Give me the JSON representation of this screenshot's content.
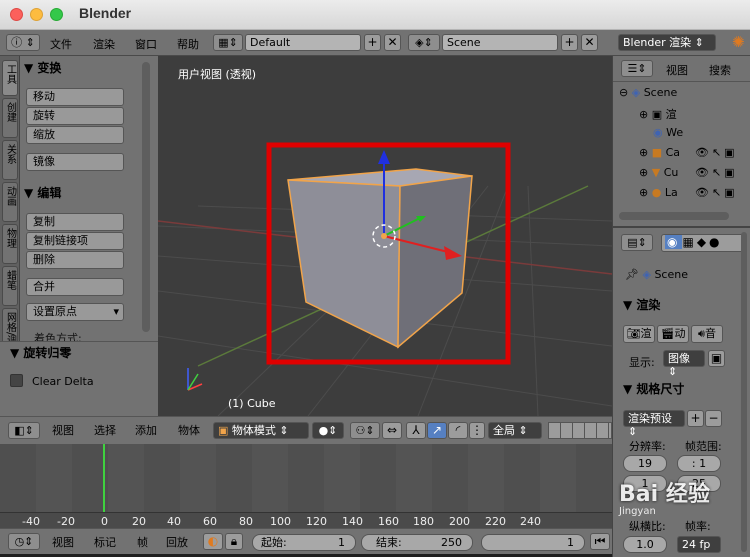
{
  "window": {
    "title": "Blender"
  },
  "infobar": {
    "menus": [
      "文件",
      "渲染",
      "窗口",
      "帮助"
    ],
    "layout": "Default",
    "scene": "Scene",
    "engine": "Blender 渲染"
  },
  "tool_tabs": [
    "工具",
    "创建",
    "关系",
    "动画",
    "物理",
    "蜡笔",
    "网格/调试"
  ],
  "toolshelf": {
    "transform_header": "变换",
    "transform_buttons": [
      "移动",
      "旋转",
      "缩放"
    ],
    "mirror": "镜像",
    "edit_header": "编辑",
    "edit_buttons": [
      "复制",
      "复制链接项",
      "删除"
    ],
    "join": "合并",
    "origin": "设置原点",
    "shading_cut": "着色方式:"
  },
  "redo": {
    "header": "旋转归零",
    "clear_delta": "Clear Delta"
  },
  "viewport": {
    "label": "用户视图 (透视)",
    "object": "(1) Cube"
  },
  "header3d": {
    "menus": [
      "视图",
      "选择",
      "添加",
      "物体"
    ],
    "mode": "物体模式",
    "orientation": "全局"
  },
  "timeline": {
    "ticks": [
      "-40",
      "-20",
      "0",
      "20",
      "40",
      "60",
      "80",
      "100",
      "120",
      "140",
      "160",
      "180",
      "200",
      "220",
      "240"
    ],
    "menus": [
      "视图",
      "标记",
      "帧",
      "回放"
    ],
    "start_label": "起始:",
    "start_value": "1",
    "end_label": "结束:",
    "end_value": "250",
    "current_value": "1",
    "fps": "24 fp"
  },
  "outliner": {
    "menus": [
      "视图",
      "搜索"
    ],
    "items": [
      "Scene",
      "渲",
      "We",
      "Ca",
      "Cu",
      "La"
    ]
  },
  "properties": {
    "scene": "Scene",
    "render_header": "渲染",
    "render_buttons": [
      "渲",
      "动",
      "音"
    ],
    "display_label": "显示:",
    "display_value": "图像",
    "dimensions_header": "规格尺寸",
    "preset": "渲染预设",
    "resolution_label": "分辨率:",
    "frame_range_label": "帧范围:",
    "res_x": "19",
    "res_y": "1",
    "start": ": 1",
    "end": "25",
    "aspect_label": "纵横比:",
    "fps_label": "帧率:",
    "aspect_value": "1.0"
  },
  "watermark": "Jingyan",
  "colors": {
    "accent": "#5680c2",
    "selection": "#f1a44a",
    "annotation": "#e00000"
  }
}
